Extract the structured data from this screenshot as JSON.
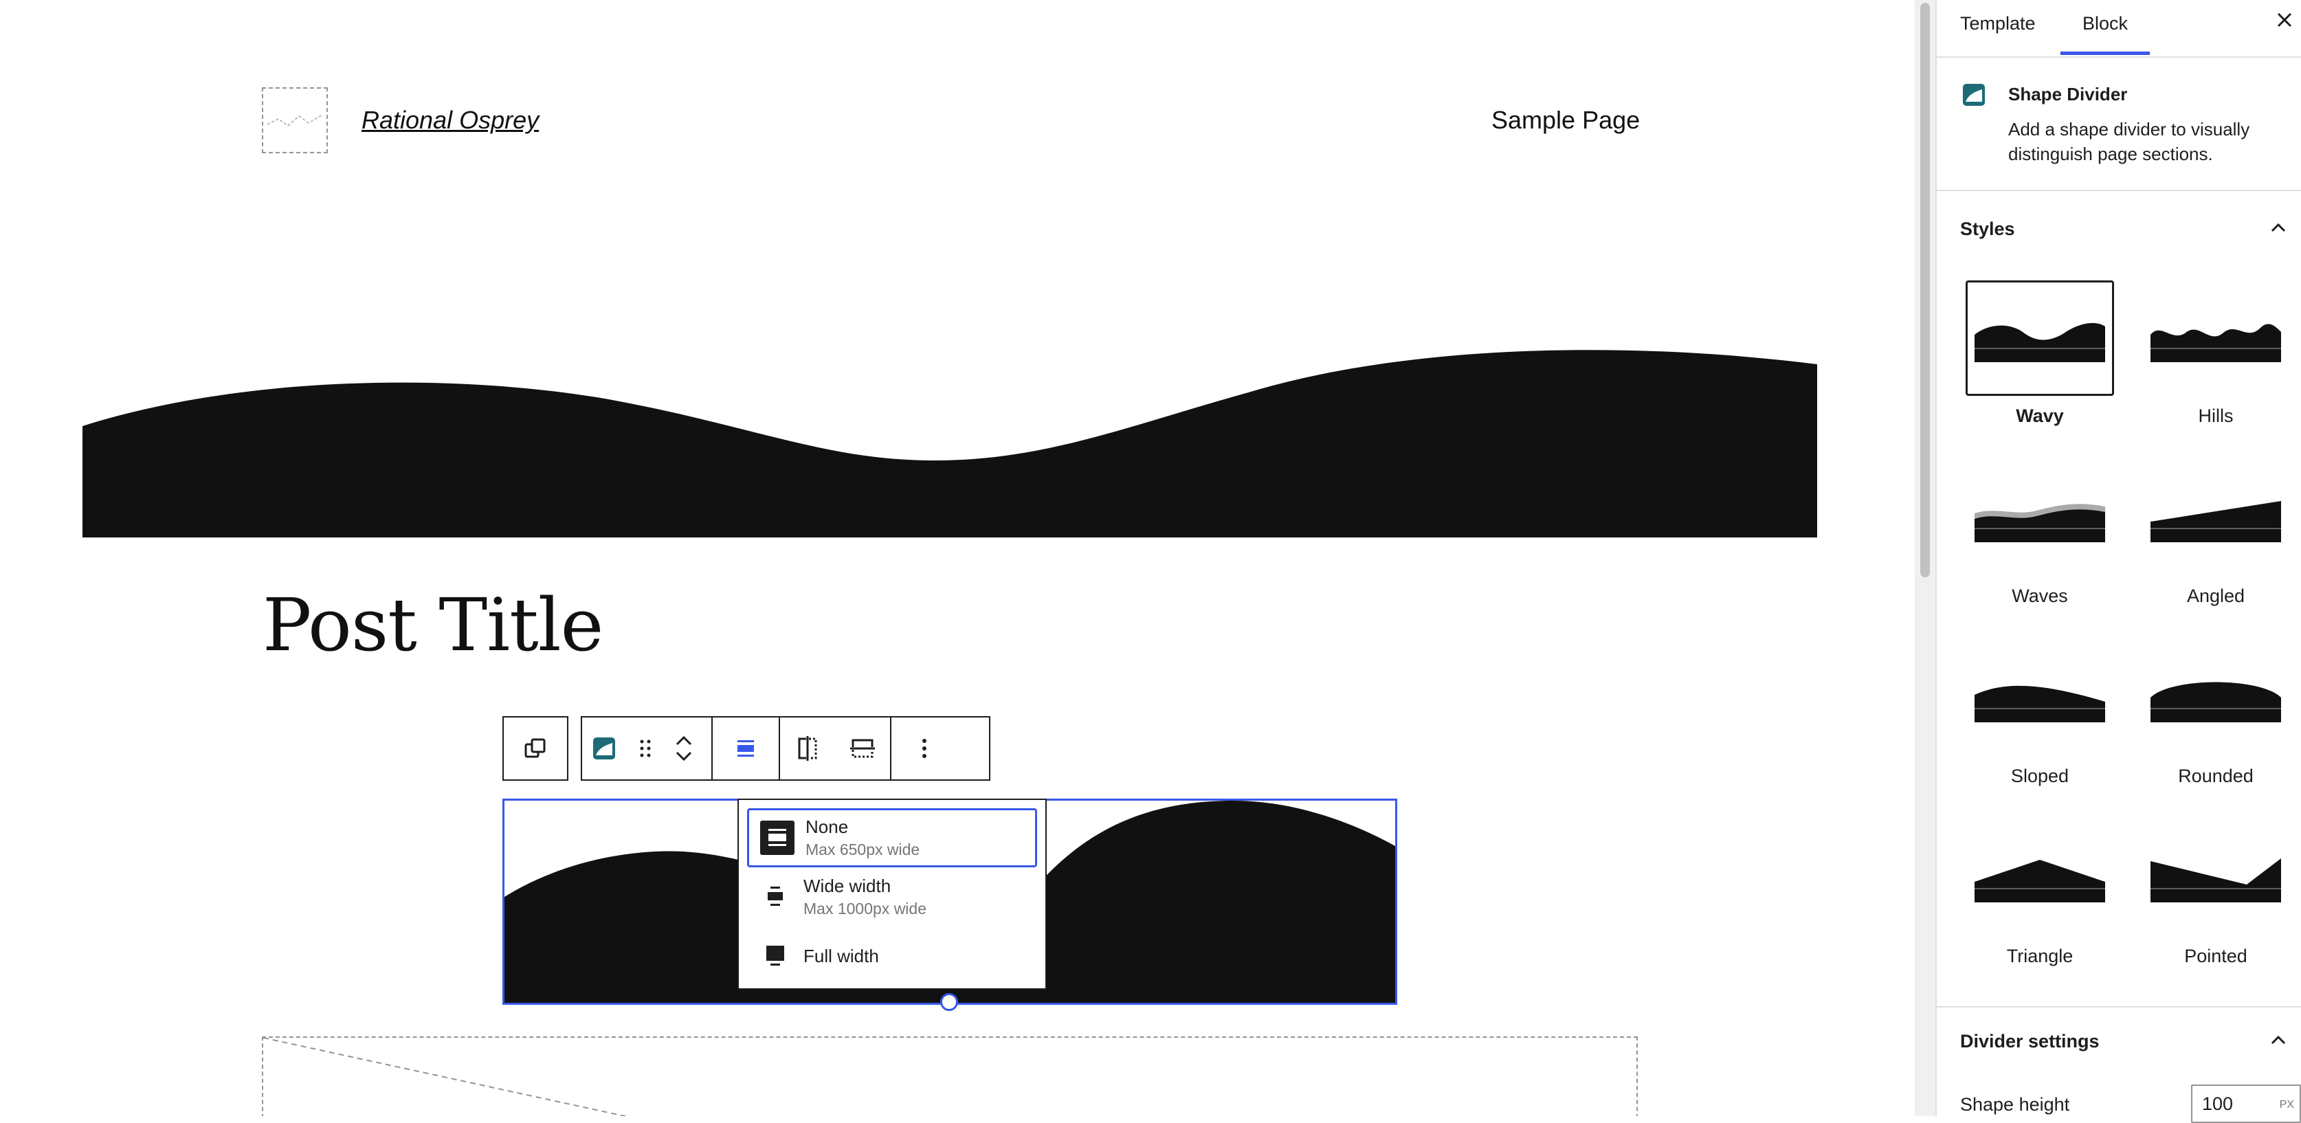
{
  "site": {
    "title": "Rational Osprey",
    "nav": [
      "Sample Page"
    ]
  },
  "post": {
    "title": "Post Title"
  },
  "toolbar": {
    "buttons": [
      "parent-block",
      "shape-divider-block-type",
      "drag-handle",
      "move-up-down",
      "align",
      "flip-horizontal",
      "flip-vertical",
      "more-options"
    ]
  },
  "align_menu": {
    "items": [
      {
        "label": "None",
        "hint": "Max 650px wide",
        "active": true
      },
      {
        "label": "Wide width",
        "hint": "Max 1000px wide",
        "active": false
      },
      {
        "label": "Full width",
        "hint": "",
        "active": false
      }
    ]
  },
  "sidebar": {
    "tabs": [
      "Template",
      "Block"
    ],
    "active_tab": "Block",
    "block": {
      "name": "Shape Divider",
      "description": "Add a shape divider to visually distinguish page sections."
    },
    "styles_panel": {
      "title": "Styles",
      "items": [
        {
          "label": "Wavy",
          "selected": true
        },
        {
          "label": "Hills",
          "selected": false
        },
        {
          "label": "Waves",
          "selected": false
        },
        {
          "label": "Angled",
          "selected": false
        },
        {
          "label": "Sloped",
          "selected": false
        },
        {
          "label": "Rounded",
          "selected": false
        },
        {
          "label": "Triangle",
          "selected": false
        },
        {
          "label": "Pointed",
          "selected": false
        }
      ]
    },
    "divider_settings": {
      "title": "Divider settings",
      "shape_height_label": "Shape height",
      "shape_height_value": "100",
      "shape_height_unit": "PX"
    }
  },
  "colors": {
    "accent": "#3858e9",
    "shape_fill": "#111111",
    "block_icon": "#1e6b78"
  }
}
